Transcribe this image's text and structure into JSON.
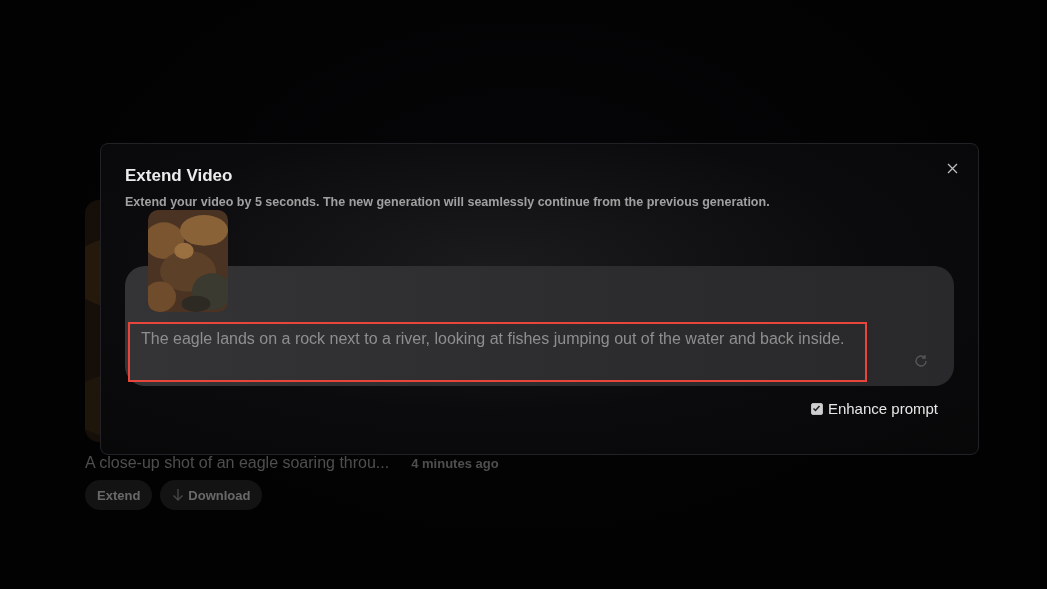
{
  "video_card": {
    "kind": "picture",
    "caption": "A close-up shot of an eagle soaring throu...",
    "time": "4 minutes ago",
    "buttons": [
      {
        "label": "Extend",
        "kind": "text"
      },
      {
        "label": "Download",
        "kind": "download"
      }
    ]
  },
  "dialog": {
    "title": "Extend Video",
    "subtitle": "Extend your video by 5 seconds. The new generation will seamlessly continue from the previous generation.",
    "prompt": {
      "value": "The eagle lands on a rock next to a river, looking at fishes jumping out of the water and back inside.",
      "highlighted": true
    },
    "enhance_prompt": {
      "label": "Enhance prompt",
      "checked": true
    }
  }
}
